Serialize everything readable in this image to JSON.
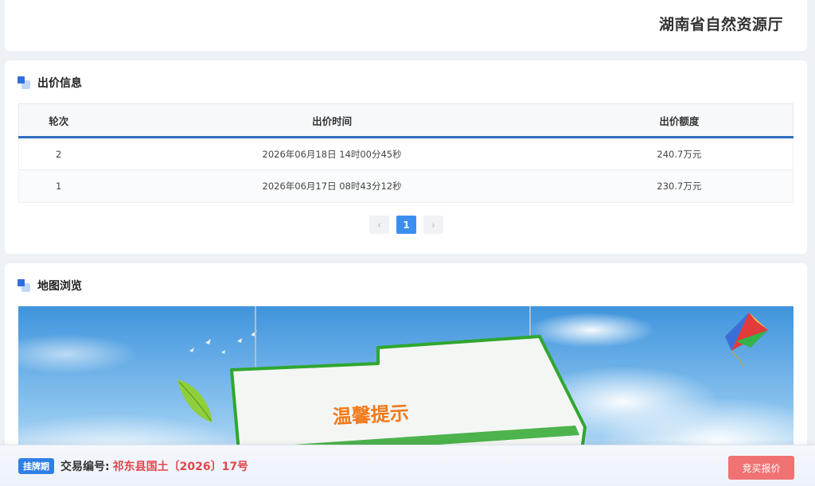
{
  "header": {
    "org_name": "湖南省自然资源厅"
  },
  "bid_section": {
    "title": "出价信息",
    "columns": {
      "round": "轮次",
      "time": "出价时间",
      "amount": "出价额度"
    },
    "rows": [
      {
        "round": "2",
        "time": "2026年06月18日 14时00分45秒",
        "amount": "240.7万元"
      },
      {
        "round": "1",
        "time": "2026年06月17日 08时43分12秒",
        "amount": "230.7万元"
      }
    ],
    "pagination": {
      "prev": "‹",
      "current": "1",
      "next": "›"
    }
  },
  "map_section": {
    "title": "地图浏览",
    "notice_text": "温馨提示"
  },
  "bottom_bar": {
    "status_badge": "挂牌期",
    "trade_label": "交易编号:",
    "trade_number": "祁东县国土〔2026〕17号",
    "bid_button": "竞买报价"
  },
  "colors": {
    "accent_blue": "#2f80e6",
    "table_header_border": "#2e6fbf",
    "trade_number_red": "#e0474e",
    "bid_button_bg": "#f07272",
    "notice_orange": "#f27a1a"
  }
}
